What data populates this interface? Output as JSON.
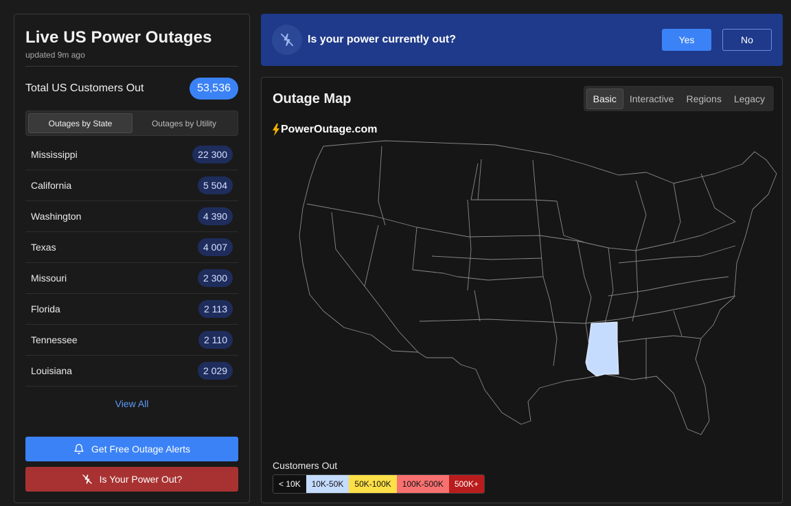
{
  "sidebar": {
    "title": "Live US Power Outages",
    "updated": "updated 9m ago",
    "total_label": "Total US Customers Out",
    "total_value": "53,536",
    "tabs": [
      {
        "label": "Outages by State",
        "active": true
      },
      {
        "label": "Outages by Utility",
        "active": false
      }
    ],
    "states": [
      {
        "name": "Mississippi",
        "count": "22 300"
      },
      {
        "name": "California",
        "count": "5 504"
      },
      {
        "name": "Washington",
        "count": "4 390"
      },
      {
        "name": "Texas",
        "count": "4 007"
      },
      {
        "name": "Missouri",
        "count": "2 300"
      },
      {
        "name": "Florida",
        "count": "2 113"
      },
      {
        "name": "Tennessee",
        "count": "2 110"
      },
      {
        "name": "Louisiana",
        "count": "2 029"
      }
    ],
    "view_all": "View All",
    "alerts_button": "Get Free Outage Alerts",
    "power_out_button": "Is Your Power Out?"
  },
  "banner": {
    "question": "Is your power currently out?",
    "yes": "Yes",
    "no": "No",
    "icon": "power-off-icon"
  },
  "map": {
    "title": "Outage Map",
    "tabs": [
      {
        "label": "Basic",
        "active": true
      },
      {
        "label": "Interactive",
        "active": false
      },
      {
        "label": "Regions",
        "active": false
      },
      {
        "label": "Legacy",
        "active": false
      }
    ],
    "brand": "PowerOutage.com",
    "highlighted_state": "Mississippi",
    "legend_title": "Customers Out",
    "legend": [
      {
        "label": "< 10K",
        "bg": "#111111",
        "fg": "#ffffff"
      },
      {
        "label": "10K-50K",
        "bg": "#c6dcff",
        "fg": "#111111"
      },
      {
        "label": "50K-100K",
        "bg": "#fde047",
        "fg": "#111111"
      },
      {
        "label": "100K-500K",
        "bg": "#f87171",
        "fg": "#111111"
      },
      {
        "label": "500K+",
        "bg": "#b91c1c",
        "fg": "#ffffff"
      }
    ]
  },
  "colors": {
    "accent": "#3b82f6",
    "banner": "#1f3a8a",
    "danger": "#a83232",
    "badge": "#1e2d5c",
    "highlight_state": "#c6dcff"
  }
}
